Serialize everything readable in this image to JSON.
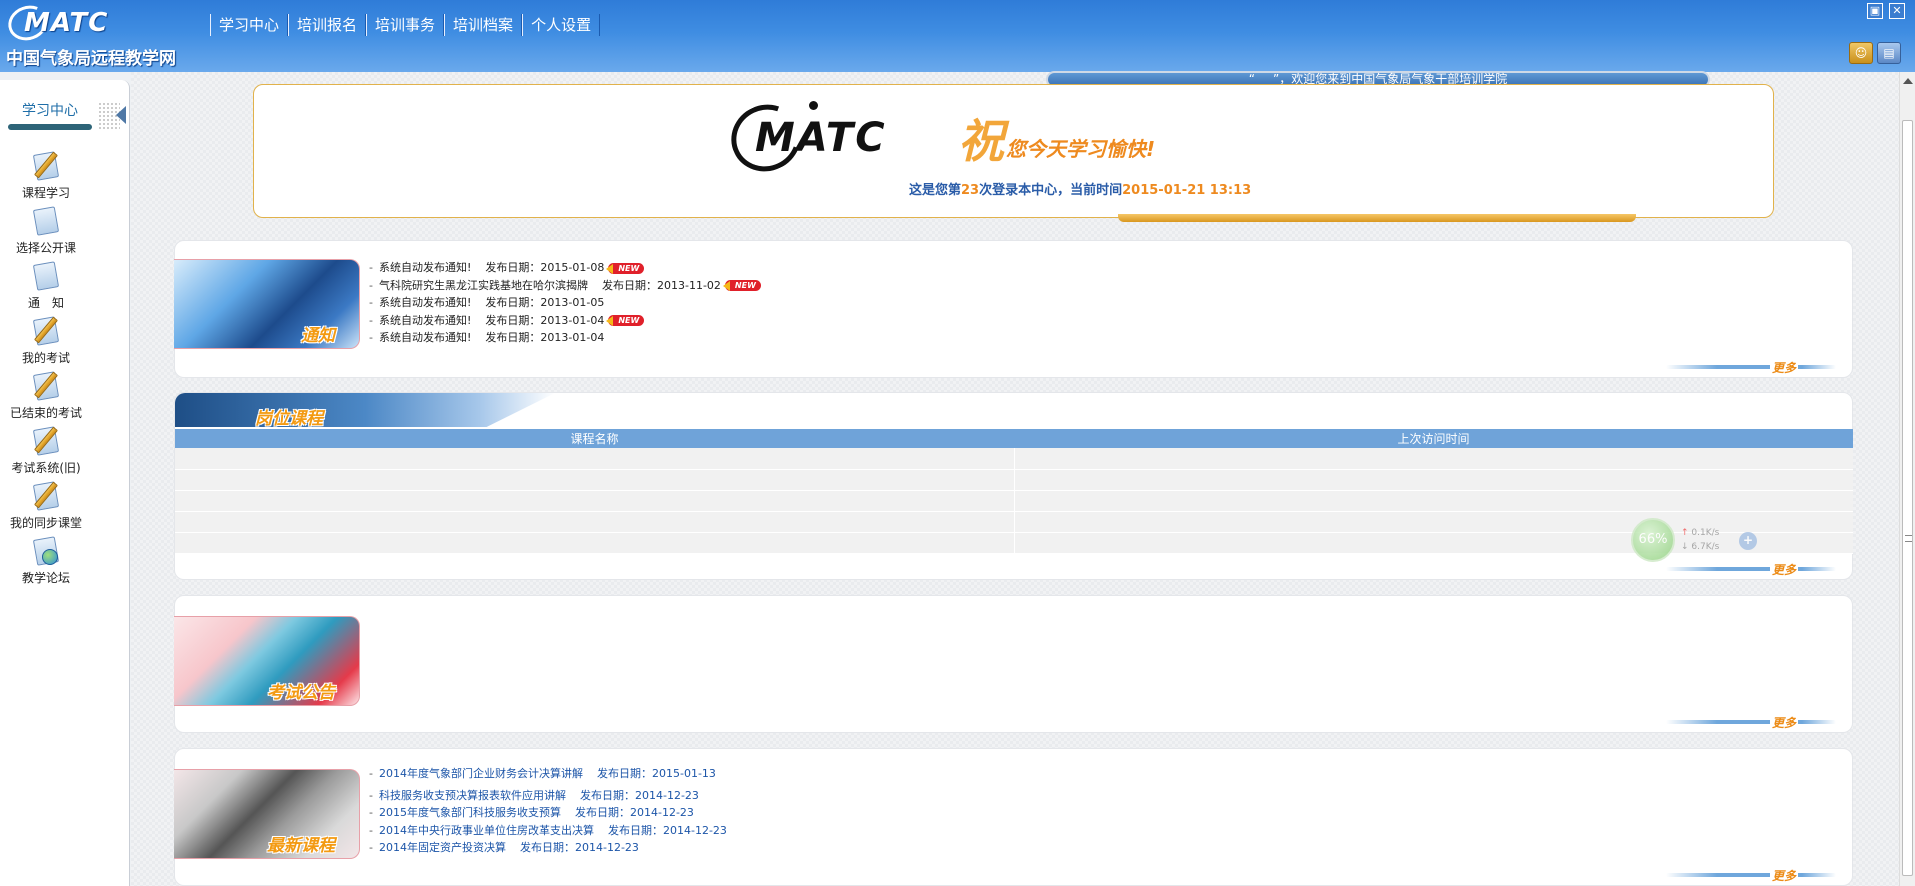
{
  "header": {
    "logo_text": "MATC",
    "logo_subtitle": "中国气象局远程教学网",
    "nav": [
      "学习中心",
      "培训报名",
      "培训事务",
      "培训档案",
      "个人设置"
    ]
  },
  "sidebar": {
    "tab_label": "学习中心",
    "items": [
      {
        "label": "课程学习",
        "icon": "course-study-icon"
      },
      {
        "label": "选择公开课",
        "icon": "public-course-icon"
      },
      {
        "label": "通　知",
        "icon": "notice-icon"
      },
      {
        "label": "我的考试",
        "icon": "my-exam-icon"
      },
      {
        "label": "已结束的考试",
        "icon": "finished-exam-icon"
      },
      {
        "label": "考试系统(旧)",
        "icon": "old-exam-system-icon"
      },
      {
        "label": "我的同步课堂",
        "icon": "sync-classroom-icon"
      },
      {
        "label": "教学论坛",
        "icon": "forum-icon"
      }
    ]
  },
  "welcome": {
    "prefix": "“",
    "name": "___",
    "suffix": "”，欢迎您来到中国气象局气象干部培训学院"
  },
  "banner": {
    "logo_text": "MATC",
    "greet_big": "祝",
    "greet": "您今天学习愉快!",
    "login_prefix": "这是您第",
    "login_count": "23",
    "login_mid": "次登录本中心，当前时间",
    "login_time": "2015-01-21 13:13"
  },
  "notices": {
    "label": "通知",
    "more": "更多",
    "items": [
      {
        "title": "系统自动发布通知!",
        "date": "发布日期：2015-01-08",
        "new": true
      },
      {
        "title": "气科院研究生黑龙江实践基地在哈尔滨揭牌",
        "date": "发布日期：2013-11-02",
        "new": true
      },
      {
        "title": "系统自动发布通知!",
        "date": "发布日期：2013-01-05",
        "new": false
      },
      {
        "title": "系统自动发布通知!",
        "date": "发布日期：2013-01-04",
        "new": true
      },
      {
        "title": "系统自动发布通知!",
        "date": "发布日期：2013-01-04",
        "new": false
      }
    ],
    "new_badge": "NEW"
  },
  "post_courses": {
    "label": "岗位课程",
    "more": "更多",
    "columns": [
      "课程名称",
      "上次访问时间"
    ]
  },
  "exam_notices": {
    "label": "考试公告",
    "more": "更多"
  },
  "new_courses": {
    "label": "最新课程",
    "more": "更多",
    "items": [
      {
        "title": "2014年度气象部门企业财务会计决算讲解",
        "date": "发布日期：2015-01-13"
      },
      {
        "title": "科技服务收支预决算报表软件应用讲解",
        "date": "发布日期：2014-12-23"
      },
      {
        "title": "2015年度气象部门科技服务收支预算",
        "date": "发布日期：2014-12-23"
      },
      {
        "title": "2014年中央行政事业单位住房改革支出决算",
        "date": "发布日期：2014-12-23"
      },
      {
        "title": "2014年固定资产投资决算",
        "date": "发布日期：2014-12-23"
      }
    ]
  },
  "netspeed": {
    "percent": "66%",
    "up": "0.1K/s",
    "down": "6.7K/s"
  }
}
